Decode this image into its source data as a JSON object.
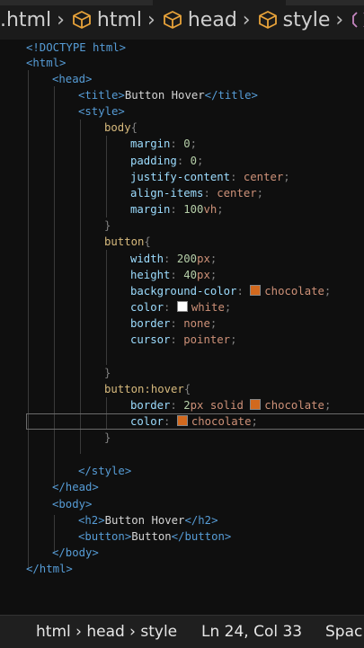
{
  "breadcrumb": {
    "items": [
      ".html",
      "html",
      "head",
      "style"
    ],
    "tail_icon": "cube-icon"
  },
  "status": {
    "path": "html › head › style",
    "position": "Ln 24, Col 33",
    "spaces": "Spac"
  },
  "code": {
    "l1": "<!DOCTYPE html>",
    "l2": "<html>",
    "l3": "<head>",
    "l4_open": "<title>",
    "l4_text": "Button Hover",
    "l4_close": "</title>",
    "l5": "<style>",
    "l6_sel": "body",
    "l6_brace": "{",
    "l7_prop": "margin",
    "l7_val": "0",
    "l8_prop": "padding",
    "l8_val": "0",
    "l9_prop": "justify-content",
    "l9_val": "center",
    "l10_prop": "align-items",
    "l10_val": "center",
    "l11_prop": "margin",
    "l11_num": "100",
    "l11_unit": "vh",
    "l12": "}",
    "l13_sel": "button",
    "l13_brace": "{",
    "l14_prop": "width",
    "l14_num": "200",
    "l14_unit": "px",
    "l15_prop": "height",
    "l15_num": "40",
    "l15_unit": "px",
    "l16_prop": "background-color",
    "l16_val": "chocolate",
    "l17_prop": "color",
    "l17_val": "white",
    "l18_prop": "border",
    "l18_val": "none",
    "l19_prop": "cursor",
    "l19_val": "pointer",
    "l21": "}",
    "l22_sel": "button:hover",
    "l22_brace": "{",
    "l23_prop": "border",
    "l23_num": "2",
    "l23_unit": "px",
    "l23_solid": "solid",
    "l23_val": "chocolate",
    "l24_prop": "color",
    "l24_val": "chocolate",
    "l25": "}",
    "l27": "</style>",
    "l28": "</head>",
    "l29": "<body>",
    "l30_open": "<h2>",
    "l30_text": "Button Hover",
    "l30_close": "</h2>",
    "l31_open": "<button>",
    "l31_text": "Button",
    "l31_close": "</button>",
    "l32": "</body>",
    "l33": "</html>"
  },
  "colors": {
    "chocolate": "#d2691e",
    "white": "#ffffff",
    "tag": "#569cd6",
    "property": "#9cdcfe",
    "selector": "#d7ba7d",
    "value": "#ce9178",
    "number": "#b5cea8"
  }
}
